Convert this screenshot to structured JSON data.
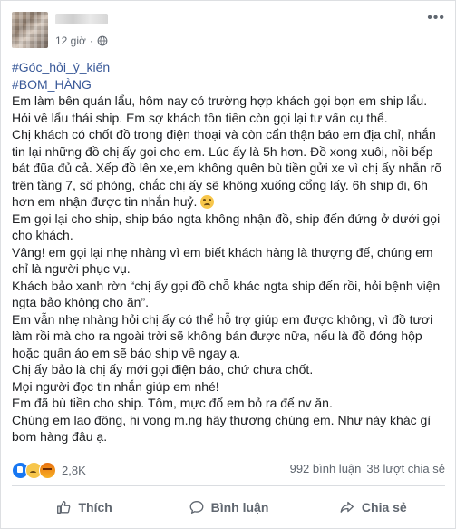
{
  "post": {
    "time": "12 giờ",
    "hashtags": [
      "#Góc_hỏi_ý_kiến",
      "#BOM_HÀNG"
    ],
    "paragraphs": [
      "Em làm bên quán lẩu, hôm nay có trường hợp khách gọi bọn em ship lẩu.",
      "Hỏi về lẩu thái ship. Em sợ khách tồn tiền còn gọi lại tư vấn cụ thể.",
      "Chị khách có chốt đồ trong điện thoại và còn cẩn thận báo em địa chỉ, nhắn tin lại những đồ chị ấy gọi cho em. Lúc ấy là 5h hơn. Đồ xong xuôi, nồi bếp bát đũa đủ cả. Xếp đồ lên xe,em không quên bù tiền gửi xe vì chị ấy nhắn rõ trên tầng 7, số phòng, chắc chị ấy sẽ không xuống cổng lấy. 6h ship đi, 6h hơn em nhận được tin nhắn huỷ.",
      "Em gọi lại cho ship, ship báo ngta không nhận đồ, ship đến đứng ở dưới gọi cho khách.",
      "Vâng! em gọi lại nhẹ nhàng vì em biết khách hàng là thượng đế, chúng em chỉ là người phục vụ.",
      "Khách bảo xanh rờn “chị ấy gọi đồ chỗ khác ngta ship đến rồi, hỏi bệnh viện ngta bảo không cho ăn”.",
      "Em vẫn nhẹ nhàng hỏi chị ấy có thể hỗ trợ giúp em được không, vì đồ tươi làm rồi mà cho ra ngoài trời sẽ không bán được nữa, nếu là đồ đóng hộp hoặc quần áo em sẽ báo ship về ngay ạ.",
      "Chị ấy bảo là chị ấy mới gọi điện báo, chứ chưa chốt.",
      "Mọi người đọc tin nhắn giúp em nhé!",
      "Em đã bù tiền cho ship. Tôm, mực đổ em bỏ ra để nv ăn.",
      "Chúng em lao động, hi vọng m.ng hãy thương chúng em. Như này khác gì bom hàng đâu ạ."
    ]
  },
  "stats": {
    "reaction_count": "2,8K",
    "comments": "992 bình luận",
    "shares": "38 lượt chia sẻ"
  },
  "actions": {
    "like": "Thích",
    "comment": "Bình luận",
    "share": "Chia sẻ"
  },
  "colors": {
    "hashtag": "#385898",
    "like_blue": "#1877f2",
    "muted": "#606770"
  }
}
